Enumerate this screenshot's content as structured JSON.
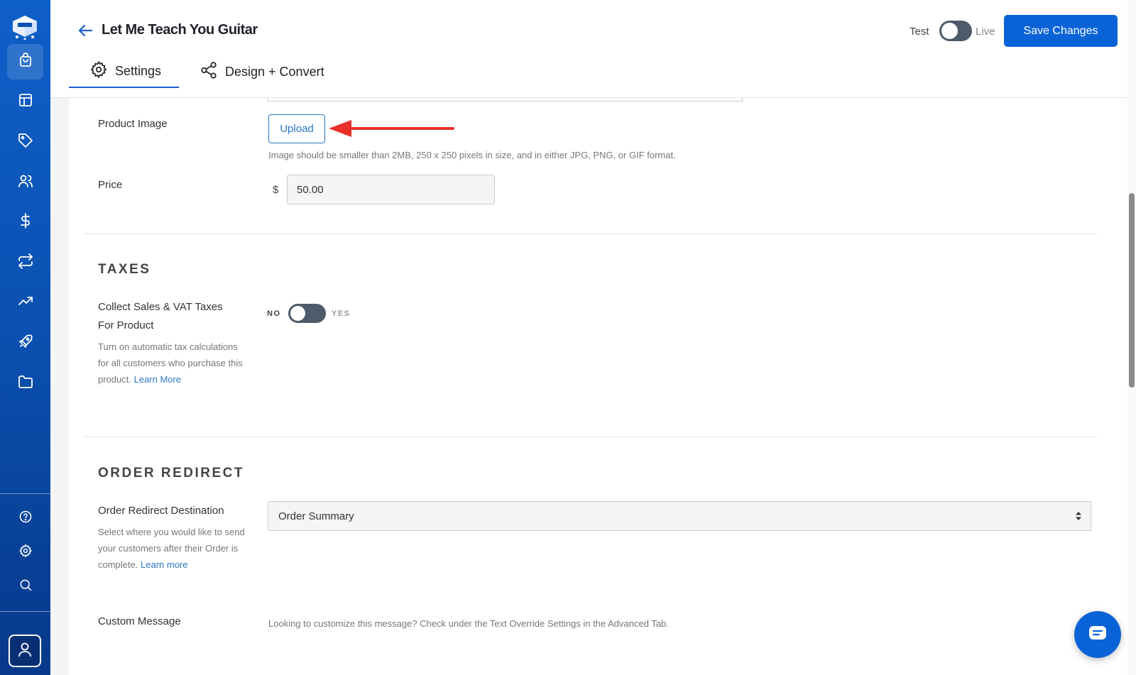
{
  "app": {
    "accent": "#0a63d6",
    "sidebar_color": "#0b52b3"
  },
  "sidebar": {
    "logo_icon": "cart-box-logo-icon",
    "items": [
      {
        "icon": "shopping-bag-icon",
        "active": true
      },
      {
        "icon": "layout-icon"
      },
      {
        "icon": "tag-icon"
      },
      {
        "icon": "users-icon"
      },
      {
        "icon": "dollar-icon"
      },
      {
        "icon": "repeat-icon"
      },
      {
        "icon": "trending-up-icon"
      },
      {
        "icon": "rocket-icon"
      },
      {
        "icon": "folder-icon"
      }
    ],
    "bottom_items": [
      {
        "icon": "help-circle-icon"
      },
      {
        "icon": "gear-icon"
      },
      {
        "icon": "search-icon"
      }
    ],
    "profile_icon": "user-icon"
  },
  "header": {
    "title": "Let Me Teach You Guitar",
    "mode": {
      "test_label": "Test",
      "live_label": "Live",
      "is_live": false
    },
    "save_label": "Save Changes",
    "tabs": [
      {
        "label": "Settings",
        "icon": "gear-icon",
        "active": true
      },
      {
        "label": "Design + Convert",
        "icon": "share-icon",
        "active": false
      }
    ]
  },
  "product": {
    "image_label": "Product Image",
    "upload_label": "Upload",
    "image_help": "Image should be smaller than 2MB, 250 x 250 pixels in size, and in either JPG, PNG, or GIF format.",
    "price_label": "Price",
    "currency_symbol": "$",
    "price_value": "50.00"
  },
  "taxes": {
    "title": "TAXES",
    "label": "Collect Sales & VAT Taxes For Product",
    "description": "Turn on automatic tax calculations for all customers who purchase this product.",
    "learn_more": "Learn More",
    "toggle_no": "NO",
    "toggle_yes": "YES",
    "enabled": false
  },
  "order_redirect": {
    "title": "ORDER REDIRECT",
    "label": "Order Redirect Destination",
    "description": "Select where you would like to send your customers after their Order is complete.",
    "learn_more": "Learn more",
    "selected": "Order Summary",
    "custom_message_label": "Custom Message",
    "custom_message_help": "Looking to customize this message? Check under the Text Override Settings in the Advanced Tab."
  },
  "chat": {
    "icon": "chat-icon"
  }
}
